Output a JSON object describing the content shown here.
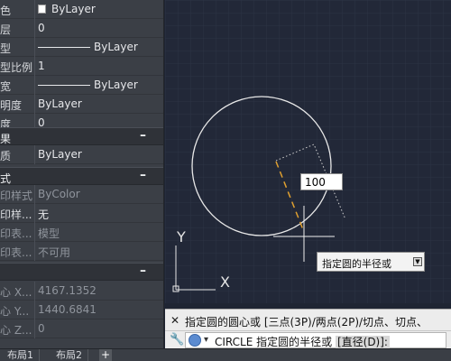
{
  "properties": {
    "rows_general": [
      {
        "label": "色",
        "value": "ByLayer",
        "swatch": true
      },
      {
        "label": "层",
        "value": "0"
      },
      {
        "label": "型",
        "value": "ByLayer",
        "linetype": true
      },
      {
        "label": "型比例",
        "value": "1"
      },
      {
        "label": "宽",
        "value": "ByLayer",
        "linetype": true
      },
      {
        "label": "明度",
        "value": "ByLayer"
      },
      {
        "label": "度",
        "value": "0"
      }
    ],
    "section_3d": {
      "label": "果",
      "toggle": "–"
    },
    "rows_3d": [
      {
        "label": "质",
        "value": "ByLayer"
      }
    ],
    "section_plot": {
      "label": "式",
      "toggle": "–"
    },
    "rows_plot": [
      {
        "label": "印样式",
        "value": "ByColor",
        "dim": true
      },
      {
        "label": "印样...",
        "value": "无"
      },
      {
        "label": "印表...",
        "value": "模型",
        "dim": true
      },
      {
        "label": "印表...",
        "value": "不可用",
        "dim": true
      }
    ],
    "section_geometry": {
      "label": "",
      "toggle": "–"
    },
    "rows_geometry": [
      {
        "label": "心 X...",
        "value": "4167.1352",
        "dim": true
      },
      {
        "label": "心 Y...",
        "value": "1440.6841",
        "dim": true
      },
      {
        "label": "心 Z...",
        "value": "0",
        "dim": true
      }
    ]
  },
  "canvas": {
    "radius_input": "100",
    "tooltip": "指定圆的半径或",
    "ucs_x": "X",
    "ucs_y": "Y",
    "colors": {
      "background": "#222838",
      "grid": "#2c3345",
      "circle": "#e8e8e8",
      "radius_line": "#e0a030"
    }
  },
  "command": {
    "close": "✕",
    "history": "指定圆的圆心或 [三点(3P)/两点(2P)/切点、切点、",
    "prompt_prefix": "CIRCLE 指定圆的半径或",
    "option": "[直径(D)]:"
  },
  "tabs": [
    {
      "label": "布局1"
    },
    {
      "label": "布局2"
    }
  ],
  "add_tab": "+"
}
